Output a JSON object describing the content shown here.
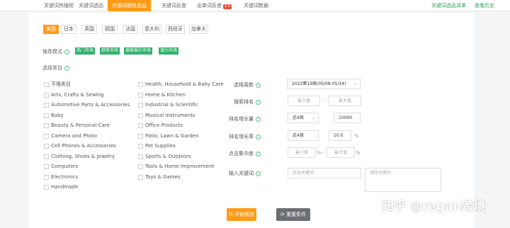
{
  "top_tabs": [
    "关键词热搜榜",
    "关键词选品",
    "关键词趋势选品",
    "关键词反查",
    "出单词反查",
    "关键词数据"
  ],
  "top_tab_badge": "2.0",
  "top_links": [
    "关键词选品清单",
    "查看历史"
  ],
  "markets": [
    "美国",
    "日本",
    "英国",
    "德国",
    "法国",
    "意大利",
    "西班牙",
    "加拿大"
  ],
  "recommend": {
    "label": "推荐模式",
    "modes": [
      "热门市场",
      "趋势市场",
      "搜索飙升市场",
      "潜力市场"
    ]
  },
  "category": {
    "label": "选择类目",
    "col1": [
      "不限类目",
      "Arts, Crafts & Sewing",
      "Automotive Parts & Accessories",
      "Baby",
      "Beauty & Personal Care",
      "Camera and Photo",
      "Cell Phones & Accessories",
      "Clothing, Shoes & Jewelry",
      "Computers",
      "Electronics",
      "Handmade"
    ],
    "col2": [
      "Health, Household & Baby Care",
      "Home & Kitchen",
      "Industrial & Scientific",
      "Musical Instruments",
      "Office Products",
      "Patio, Lawn & Garden",
      "Pet Supplies",
      "Sports & Outdoors",
      "Tools & Home Improvement",
      "Toys & Games"
    ]
  },
  "filters": {
    "week": {
      "label": "选择周数",
      "value": "2022第19周(05/08-05/14)"
    },
    "search_rank": {
      "label": "搜索排名",
      "min": "最小值",
      "max": "最大值"
    },
    "rank_growth_count": {
      "label": "排名增长量",
      "period": "近4周",
      "value": "10000"
    },
    "rank_growth_rate": {
      "label": "排名增长率",
      "period": "近4周",
      "value": "10.0",
      "unit": "%"
    },
    "click_concentration": {
      "label": "点击集中度",
      "min": "最小值",
      "max": "最大值",
      "unit": "%"
    },
    "keyword": {
      "label": "输入关键词",
      "include_placeholder": "包含关键词",
      "exclude_placeholder": "排除关键词"
    }
  },
  "buttons": {
    "start": "开始筛选",
    "reset": "重置条件"
  },
  "watermark": "知乎 @regan跨境",
  "colors": {
    "accent": "#ff9a17",
    "green": "#2fb06b",
    "reset": "#6b6f73"
  }
}
